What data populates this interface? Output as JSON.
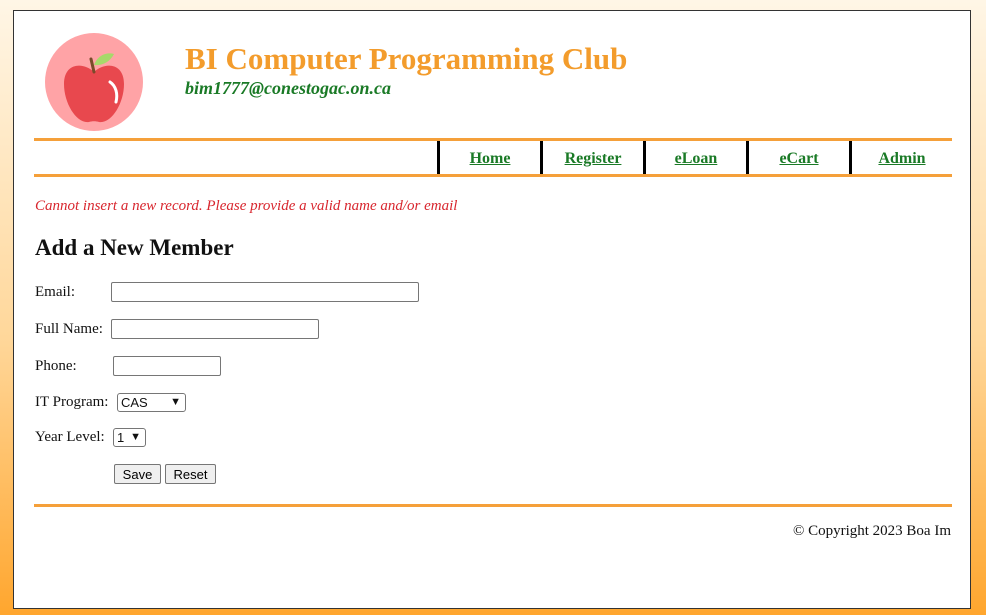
{
  "header": {
    "title": "BI Computer Programming Club",
    "email": "bim1777@conestogac.on.ca",
    "logo": "apple-icon"
  },
  "nav": [
    {
      "label": "Home"
    },
    {
      "label": "Register"
    },
    {
      "label": "eLoan"
    },
    {
      "label": "eCart"
    },
    {
      "label": "Admin"
    }
  ],
  "error_message": "Cannot insert a new record. Please provide a valid name and/or email",
  "form": {
    "title": "Add a New Member",
    "email_label": "Email:",
    "email_value": "",
    "fullname_label": "Full Name:",
    "fullname_value": "",
    "phone_label": "Phone:",
    "phone_value": "",
    "program_label": "IT Program:",
    "program_selected": "CAS",
    "year_label": "Year Level:",
    "year_selected": "1",
    "save_label": "Save",
    "reset_label": "Reset"
  },
  "footer": {
    "copyright": "© Copyright 2023 Boa Im"
  },
  "colors": {
    "accent": "#f5a03a",
    "title": "#f39c2c",
    "link": "#1a7a26",
    "error": "#d8262e"
  }
}
